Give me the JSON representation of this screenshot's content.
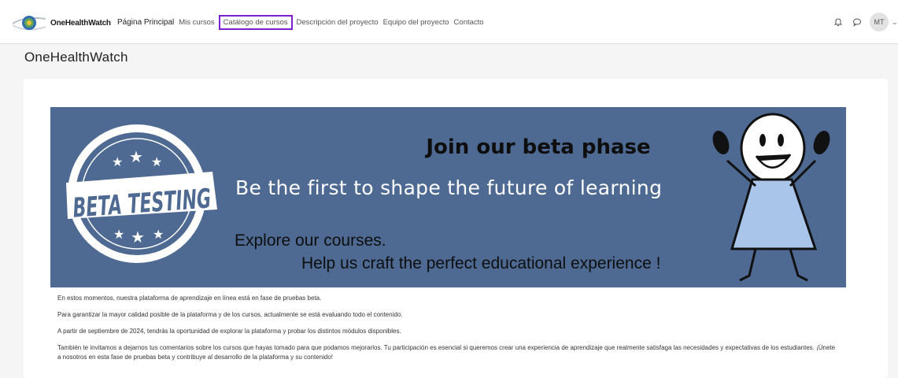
{
  "brand": {
    "name": "OneHealthWatch"
  },
  "nav": {
    "items": [
      {
        "label": "Página Principal",
        "state": "active"
      },
      {
        "label": "Mis cursos",
        "state": "normal"
      },
      {
        "label": "Catálogo de cursos",
        "state": "highlight"
      },
      {
        "label": "Descripción del proyecto",
        "state": "normal"
      },
      {
        "label": "Equipo del proyecto",
        "state": "normal"
      },
      {
        "label": "Contacto",
        "state": "normal"
      }
    ]
  },
  "user": {
    "initials": "MT",
    "chevron": "⌄"
  },
  "icons": {
    "notifications": "bell-icon",
    "messages": "chat-bubble-icon"
  },
  "page": {
    "title": "OneHealthWatch"
  },
  "banner": {
    "heading": "Join our beta phase",
    "subheading": "Be the first to shape the future of learning",
    "explore": "Explore our courses.",
    "help": "Help us craft the perfect educational experience !",
    "badge_text": "BETA TESTING",
    "background": "#4e6a93"
  },
  "paragraphs": [
    "En estos momentos, nuestra plataforma de aprendizaje en línea está en fase de pruebas beta.",
    "Para garantizar la mayor calidad posible de la plataforma y de los cursos, actualmente se está evaluando todo el contenido.",
    "A partir de septiembre de 2024, tendrás la oportunidad de explorar la plataforma y probar los distintos módulos disponibles.",
    "También te invitamos a dejarnos tus comentarios sobre los cursos que hayas tomado para que podamos mejorarlos. Tu participación es esencial si queremos crear una experiencia de aprendizaje que realmente satisfaga las necesidades y expectativas de los estudiantes. ¡Únete a nosotros en esta fase de pruebas beta y contribuye al desarrollo de la plataforma y su contenido!"
  ],
  "colors": {
    "highlight_border": "#7a1fd1",
    "banner_bg": "#4e6a93"
  }
}
